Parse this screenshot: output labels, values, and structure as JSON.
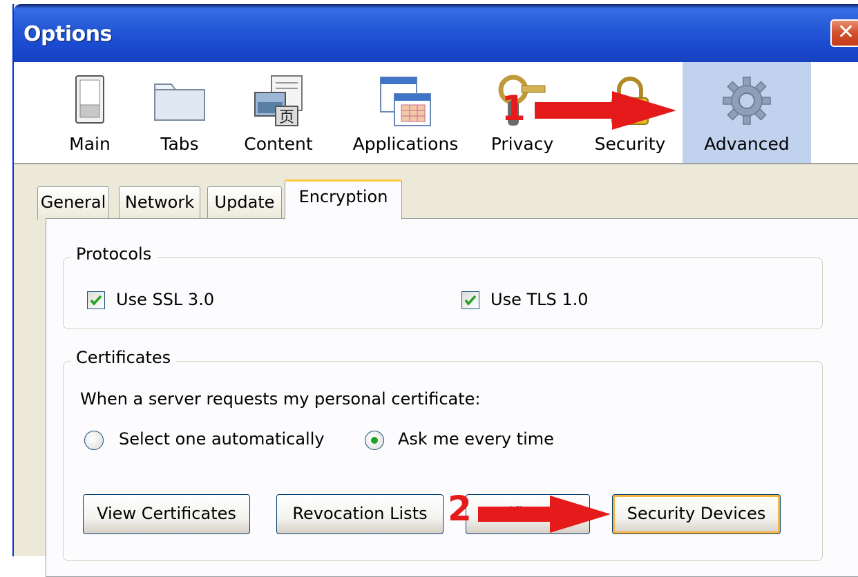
{
  "window": {
    "title": "Options",
    "close_symbol": "✕"
  },
  "toolbar": {
    "items": [
      {
        "label": "Main",
        "icon": "switch-icon"
      },
      {
        "label": "Tabs",
        "icon": "folder-tabs-icon"
      },
      {
        "label": "Content",
        "icon": "content-icon"
      },
      {
        "label": "Applications",
        "icon": "applications-icon"
      },
      {
        "label": "Privacy",
        "icon": "key-icon"
      },
      {
        "label": "Security",
        "icon": "padlock-icon"
      },
      {
        "label": "Advanced",
        "icon": "gear-icon"
      }
    ],
    "selected": "Advanced",
    "content_icon_glyph": "页"
  },
  "tabs": {
    "items": [
      {
        "label": "General"
      },
      {
        "label": "Network"
      },
      {
        "label": "Update"
      },
      {
        "label": "Encryption"
      }
    ],
    "selected": "Encryption"
  },
  "protocols": {
    "legend": "Protocols",
    "ssl": {
      "label": "Use SSL 3.0",
      "checked": true
    },
    "tls": {
      "label": "Use TLS 1.0",
      "checked": true
    }
  },
  "certificates": {
    "legend": "Certificates",
    "prompt": "When a server requests my personal certificate:",
    "options": [
      {
        "label": "Select one automatically",
        "selected": false
      },
      {
        "label": "Ask me every time",
        "selected": true
      }
    ],
    "buttons": {
      "view": "View Certificates",
      "revocation": "Revocation Lists",
      "verification": "Verification",
      "security_devices": "Security Devices"
    }
  },
  "annotations": {
    "step1": "1",
    "step2": "2",
    "arrow_color": "#e51b1b"
  },
  "colors": {
    "titlebar": "#2659d6",
    "selected_toolbar": "#c1d2ee",
    "tab_highlight": "#ffc83c",
    "dialog_bg": "#ece9d8"
  }
}
